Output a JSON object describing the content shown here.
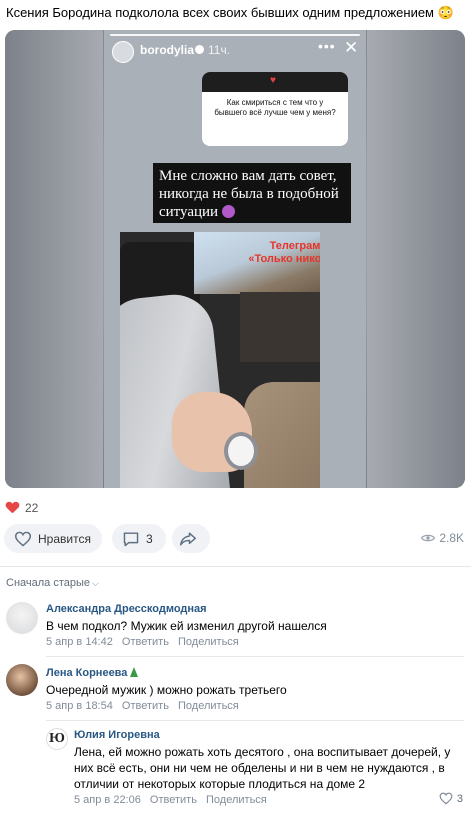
{
  "post": {
    "text": "Ксения Бородина подколола всех своих бывших одним предложением",
    "story": {
      "username": "borodylia",
      "time": "11ч.",
      "question": "Как смириться с тем что у бывшего всё лучше чем у меня?",
      "answer": "Мне сложно вам дать совет, никогда не была в подобной ситуации",
      "caption_line1": "Телеграм",
      "caption_line2": "«Только никому»"
    },
    "reactions_count": "22",
    "like_label": "Нравится",
    "comments_count": "3",
    "views": "2.8K"
  },
  "comments_sort": "Сначала старые",
  "comments": [
    {
      "author": "Александра Дресскодмодная",
      "text": "В чем подкол? Мужик ей изменил другой нашелся",
      "date": "5 апр в 14:42",
      "reply_label": "Ответить",
      "share_label": "Поделиться"
    },
    {
      "author": "Лена Корнеева",
      "text": "Очередной мужик ) можно рожать третьего",
      "date": "5 апр в 18:54",
      "reply_label": "Ответить",
      "share_label": "Поделиться"
    },
    {
      "author": "Юлия Игоревна",
      "text": "Лена, ей можно рожать хоть десятого , она воспитывает дочерей, у них всё есть, они ни чем не обделены и ни в чем не нуждаются , в отличии от некоторых которые плодиться на доме 2",
      "date": "5 апр в 22:06",
      "reply_label": "Ответить",
      "share_label": "Поделиться",
      "likes": "3",
      "avatar_text": "Ю"
    }
  ],
  "colors": {
    "link": "#2a5885",
    "heart": "#e64646",
    "muted": "#818c99"
  }
}
